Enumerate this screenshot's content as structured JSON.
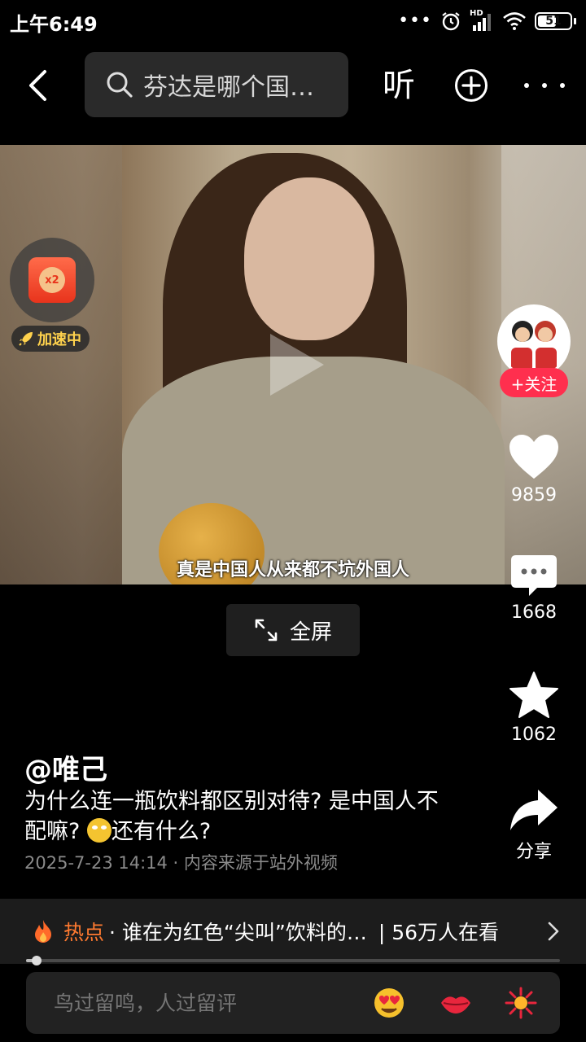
{
  "status_bar": {
    "time": "上午6:49",
    "network": "HD",
    "battery": "51"
  },
  "top_nav": {
    "search_text": "芬达是哪个国…",
    "listen_label": "听"
  },
  "video": {
    "subtitle": "真是中国人从来都不坑外国人",
    "fullscreen_label": "全屏"
  },
  "red_packet": {
    "multiplier": "x2",
    "boost_label": "加速中"
  },
  "side_actions": {
    "follow_label": "+关注",
    "likes": "9859",
    "comments": "1668",
    "favorites": "1062",
    "share_label": "分享"
  },
  "post": {
    "author": "@唯己",
    "description_part1": "为什么连一瓶饮料都区别对待? 是中国人不配嘛? ",
    "description_part2": "还有什么?",
    "meta": "2025-7-23 14:14 · 内容来源于站外视频"
  },
  "hot": {
    "label": "热点",
    "text": "· 谁在为红色“尖叫”饮料的…",
    "viewers": "| 56万人在看"
  },
  "progress": {
    "value": 0.02
  },
  "comment_bar": {
    "placeholder": "鸟过留鸣，人过留评"
  },
  "colors": {
    "accent_red": "#ff2f4e",
    "hot_orange": "#ff7a30",
    "boost_yellow": "#ffd24d"
  }
}
